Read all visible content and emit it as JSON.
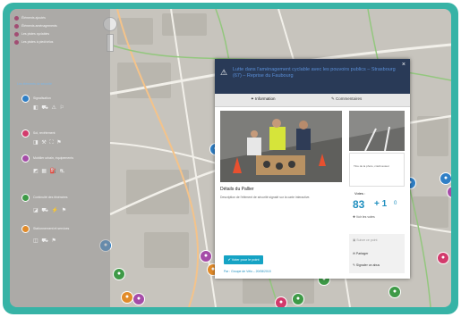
{
  "frame_color": "#37b3a6",
  "left_panel": {
    "layers": [
      {
        "label": "Éléments ajoutés",
        "color": "#a24d73"
      },
      {
        "label": "Éléments aménagements",
        "color": "#a24d73"
      },
      {
        "label": "Les pistes cyclables",
        "color": "#a24d73"
      },
      {
        "label": "Les pistes à pied/vélos",
        "color": "#a24d73"
      }
    ],
    "section_title": "Les éléments de sécurité",
    "categories": [
      {
        "label": "Signalisation",
        "color": "#2f7fc6",
        "icons": "◧ ⛟ ⚠ ⚐"
      },
      {
        "label": "Sol, revêtement",
        "color": "#d23b6c",
        "icons": "◨ ⚒ ⛶ ⚑"
      },
      {
        "label": "Mobilier urbain, équipements",
        "color": "#a54ca8",
        "icons": "◩ ▦ ⛽ ⛐"
      },
      {
        "label": "Continuité des itinéraires",
        "color": "#3e9a47",
        "icons": "◪ ⛟ ⚡ ⚑"
      },
      {
        "label": "Stationnement et services",
        "color": "#e18b2a",
        "icons": "◫ ⛟ ⚑"
      }
    ]
  },
  "modal": {
    "title": "Lutte dans l'aménagement cyclable avec les pouvoirs publics – Strasbourg (67) – Reprise du Faubourg",
    "warning_icon": "⚠",
    "close_icon": "×",
    "tab_info": "✦ Information",
    "tab_comments": "✎ Commentaires",
    "image_caption": "Titre de la photo, crédit auteur",
    "section_label": "Détails du Pallier",
    "description": "Description de l'élément de sécurité signalé sur la carte interactive.",
    "vote_label": "Votes :",
    "votes_up": "83",
    "votes_sep": "+ 1",
    "votes_down": "0",
    "vote_link": "✚ Voir les votes",
    "side_links": [
      "▣ Suivre ce point",
      "✉ Partager",
      "✎ Signaler un abus"
    ],
    "vote_button": "✔ Voter pour le point",
    "footer_text": "Par : Groupe de Vélo – 20/08/2015"
  }
}
